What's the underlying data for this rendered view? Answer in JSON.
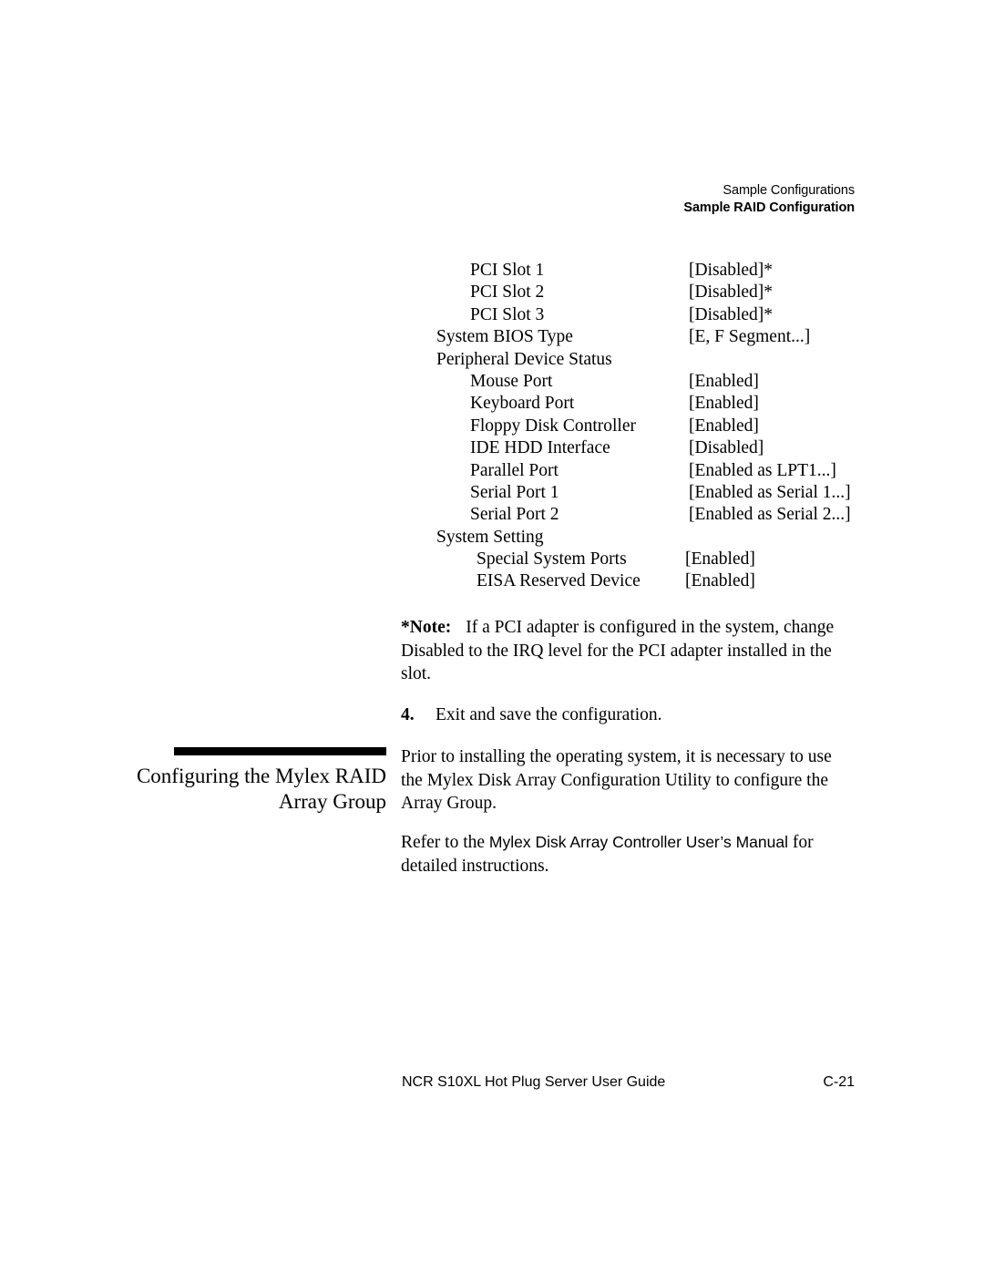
{
  "running_head": {
    "line1": "Sample Configurations",
    "line2": "Sample RAID Configuration"
  },
  "settings": {
    "rows": [
      {
        "level": 1,
        "key": "PCI Slot 1",
        "value": "[Disabled]*"
      },
      {
        "level": 1,
        "key": "PCI Slot 2",
        "value": "[Disabled]*"
      },
      {
        "level": 1,
        "key": "PCI Slot 3",
        "value": "[Disabled]*"
      },
      {
        "level": 0,
        "key": "System BIOS Type",
        "value": "[E, F Segment...]"
      },
      {
        "level": 0,
        "key": "Peripheral Device Status",
        "value": ""
      },
      {
        "level": 1,
        "key": "Mouse Port",
        "value": "[Enabled]"
      },
      {
        "level": 1,
        "key": "Keyboard Port",
        "value": "[Enabled]"
      },
      {
        "level": 1,
        "key": "Floppy Disk Controller",
        "value": "[Enabled]"
      },
      {
        "level": 1,
        "key": "IDE HDD Interface",
        "value": "[Disabled]"
      },
      {
        "level": 1,
        "key": "Parallel Port",
        "value": "[Enabled as LPT1...]"
      },
      {
        "level": 1,
        "key": "Serial Port 1",
        "value": "[Enabled as Serial 1...]"
      },
      {
        "level": 1,
        "key": "Serial Port 2",
        "value": "[Enabled as Serial 2...]"
      },
      {
        "level": 0,
        "key": "System Setting",
        "value": ""
      },
      {
        "level": 2,
        "key": "Special System Ports",
        "value": "[Enabled]"
      },
      {
        "level": 2,
        "key": "EISA Reserved Device",
        "value": "[Enabled]"
      }
    ]
  },
  "note": {
    "label": "*Note:",
    "text": "If a PCI adapter is configured in the system, change Disabled to the IRQ level for the PCI adapter installed in the slot."
  },
  "step": {
    "number": "4.",
    "text": "Exit and save the configuration."
  },
  "section": {
    "heading": "Configuring the Mylex RAID Array Group"
  },
  "paragraphs": {
    "para1": "Prior to installing the operating system, it is necessary to use the Mylex Disk Array Configuration Utility to configure the Array Group.",
    "para2_before": "Refer to the ",
    "para2_title": "Mylex Disk Array Controller User’s  Manual",
    "para2_after": " for detailed instructions."
  },
  "footer": {
    "left": "NCR S10XL Hot Plug Server User Guide",
    "right": "C-21"
  }
}
